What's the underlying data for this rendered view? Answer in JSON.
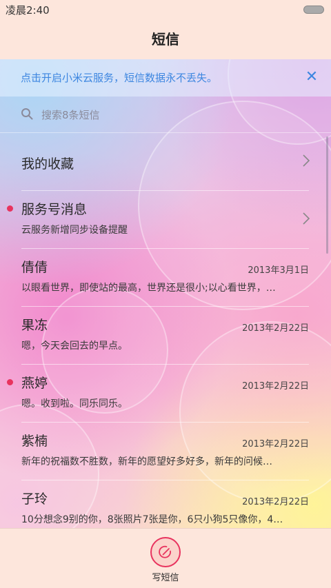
{
  "status_bar": {
    "time": "凌晨2:40"
  },
  "header": {
    "title": "短信"
  },
  "banner": {
    "text": "点击开启小米云服务，短信数据永不丢失。",
    "close_icon": "close-icon"
  },
  "search": {
    "placeholder": "搜索8条短信",
    "icon": "search-icon"
  },
  "conversations": [
    {
      "name": "我的收藏",
      "preview": "",
      "date": "",
      "unread": false,
      "chevron": true
    },
    {
      "name": "服务号消息",
      "preview": "云服务新增同步设备提醒",
      "date": "",
      "unread": true,
      "chevron": true
    },
    {
      "name": "倩倩",
      "preview": "以眼看世界，即使站的最高，世界还是很小;以心看世界，…",
      "date": "2013年3月1日",
      "unread": false,
      "chevron": false
    },
    {
      "name": "果冻",
      "preview": "嗯，今天会回去的早点。",
      "date": "2013年2月22日",
      "unread": false,
      "chevron": false
    },
    {
      "name": "燕婷",
      "preview": "嗯。收到啦。同乐同乐。",
      "date": "2013年2月22日",
      "unread": true,
      "chevron": false
    },
    {
      "name": "紫楠",
      "preview": "新年的祝福数不胜数，新年的愿望好多好多，新年的问候…",
      "date": "2013年2月22日",
      "unread": false,
      "chevron": false
    },
    {
      "name": "子玲",
      "preview": "10分想念9别的你，8张照片7张是你，6只小狗5只像你，4…",
      "date": "2013年2月22日",
      "unread": false,
      "chevron": false
    }
  ],
  "bottom": {
    "compose_label": "写短信",
    "compose_icon": "compose-icon"
  },
  "colors": {
    "accent": "#e8335e",
    "link": "#3d86e0",
    "background": "#fde6dc"
  }
}
